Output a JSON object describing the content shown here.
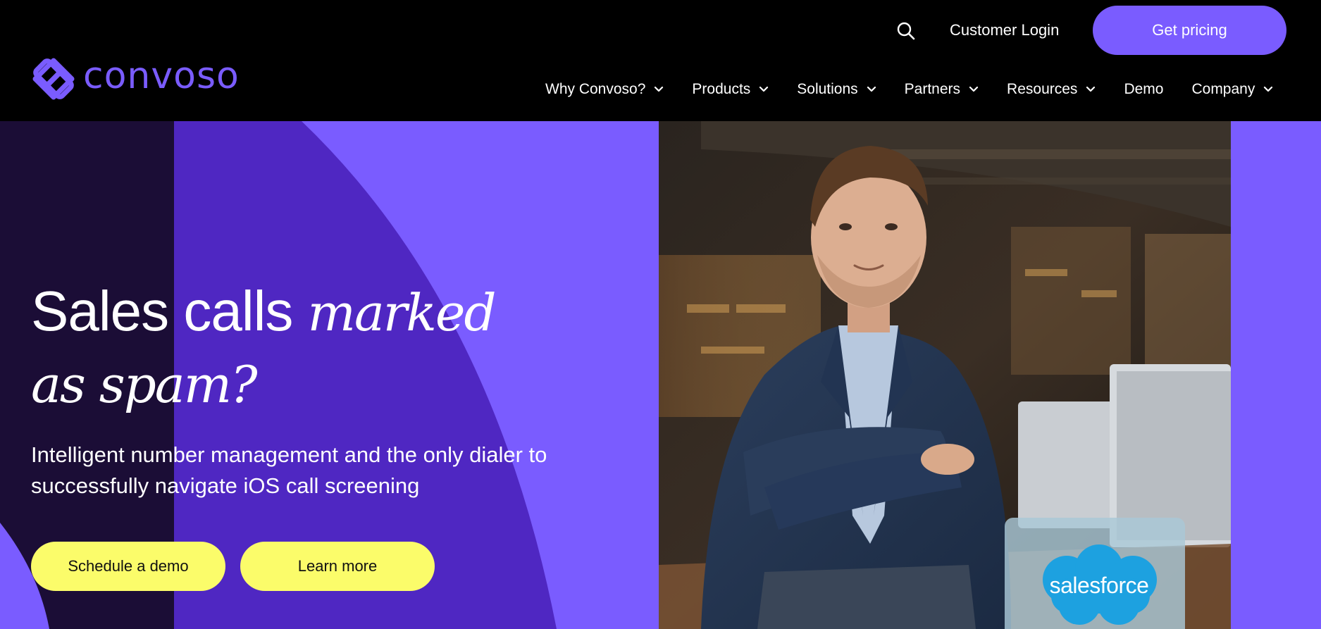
{
  "header": {
    "logo_text": "convoso",
    "customer_login": "Customer Login",
    "get_pricing": "Get pricing"
  },
  "nav": [
    {
      "label": "Why Convoso?",
      "has_dropdown": true
    },
    {
      "label": "Products",
      "has_dropdown": true
    },
    {
      "label": "Solutions",
      "has_dropdown": true
    },
    {
      "label": "Partners",
      "has_dropdown": true
    },
    {
      "label": "Resources",
      "has_dropdown": true
    },
    {
      "label": "Demo",
      "has_dropdown": false
    },
    {
      "label": "Company",
      "has_dropdown": true
    }
  ],
  "hero": {
    "headline_regular": "Sales calls ",
    "headline_italic_1": "marked",
    "headline_italic_2": "as spam?",
    "subtext": "Intelligent number management and the only dialer to successfully navigate iOS call screening",
    "primary_cta": "Schedule a demo",
    "secondary_cta": "Learn more",
    "badge_text": "salesforce"
  },
  "colors": {
    "brand_purple": "#7a5cff",
    "deep_purple": "#4f27c2",
    "darkest_purple": "#1b0d36",
    "cta_yellow": "#fbfc6a",
    "salesforce_blue": "#1da1e0"
  },
  "icons": [
    "search-icon",
    "chevron-down-icon",
    "convoso-logo-icon"
  ]
}
